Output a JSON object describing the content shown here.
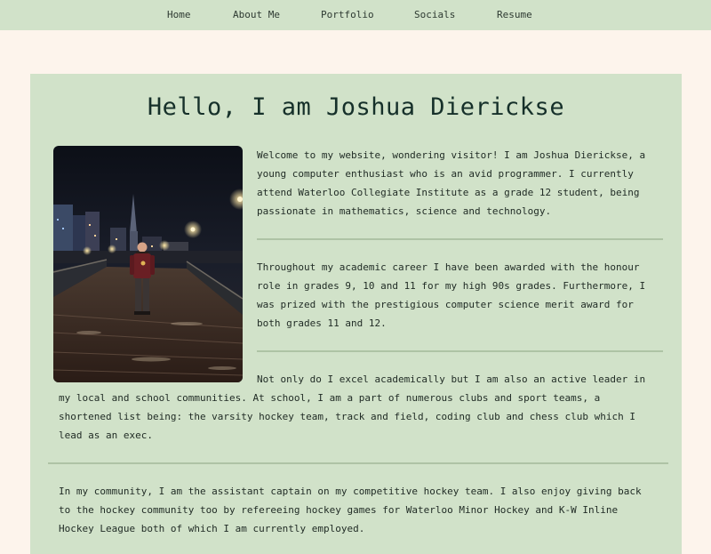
{
  "nav": {
    "items": [
      {
        "label": "Home"
      },
      {
        "label": "About Me"
      },
      {
        "label": "Portfolio"
      },
      {
        "label": "Socials"
      },
      {
        "label": "Resume"
      }
    ]
  },
  "colors": {
    "page_background": "#fdf4ec",
    "nav_background": "#d1e2c9",
    "card_background": "#d1e2c9",
    "divider": "#aec3a5",
    "text": "#1f2a24"
  },
  "main": {
    "title": "Hello, I am Joshua Dierickse",
    "photo_alt": "Joshua standing on a wooden pier at night with a city skyline behind",
    "paragraphs": [
      "Welcome to my website, wondering visitor! I am Joshua Dierickse, a young computer enthusiast who is an avid programmer. I currently attend Waterloo Collegiate Institute as a grade 12 student, being passionate in mathematics, science and technology.",
      "Throughout my academic career I have been awarded with the honour role in grades 9, 10 and 11 for my high 90s grades. Furthermore, I was prized with the prestigious computer science merit award for both grades 11 and 12.",
      "Not only do I excel academically but I am also an active leader in my local and school communities. At school, I am a part of numerous clubs and sport teams, a shortened list being: the varsity hockey team, track and field, coding club and chess club which I lead as an exec.",
      "In my community, I am the assistant captain on my competitive hockey team. I also enjoy giving back to the hockey community too by refereeing hockey games for Waterloo Minor Hockey and K-W Inline Hockey League both of which I am currently employed."
    ]
  }
}
